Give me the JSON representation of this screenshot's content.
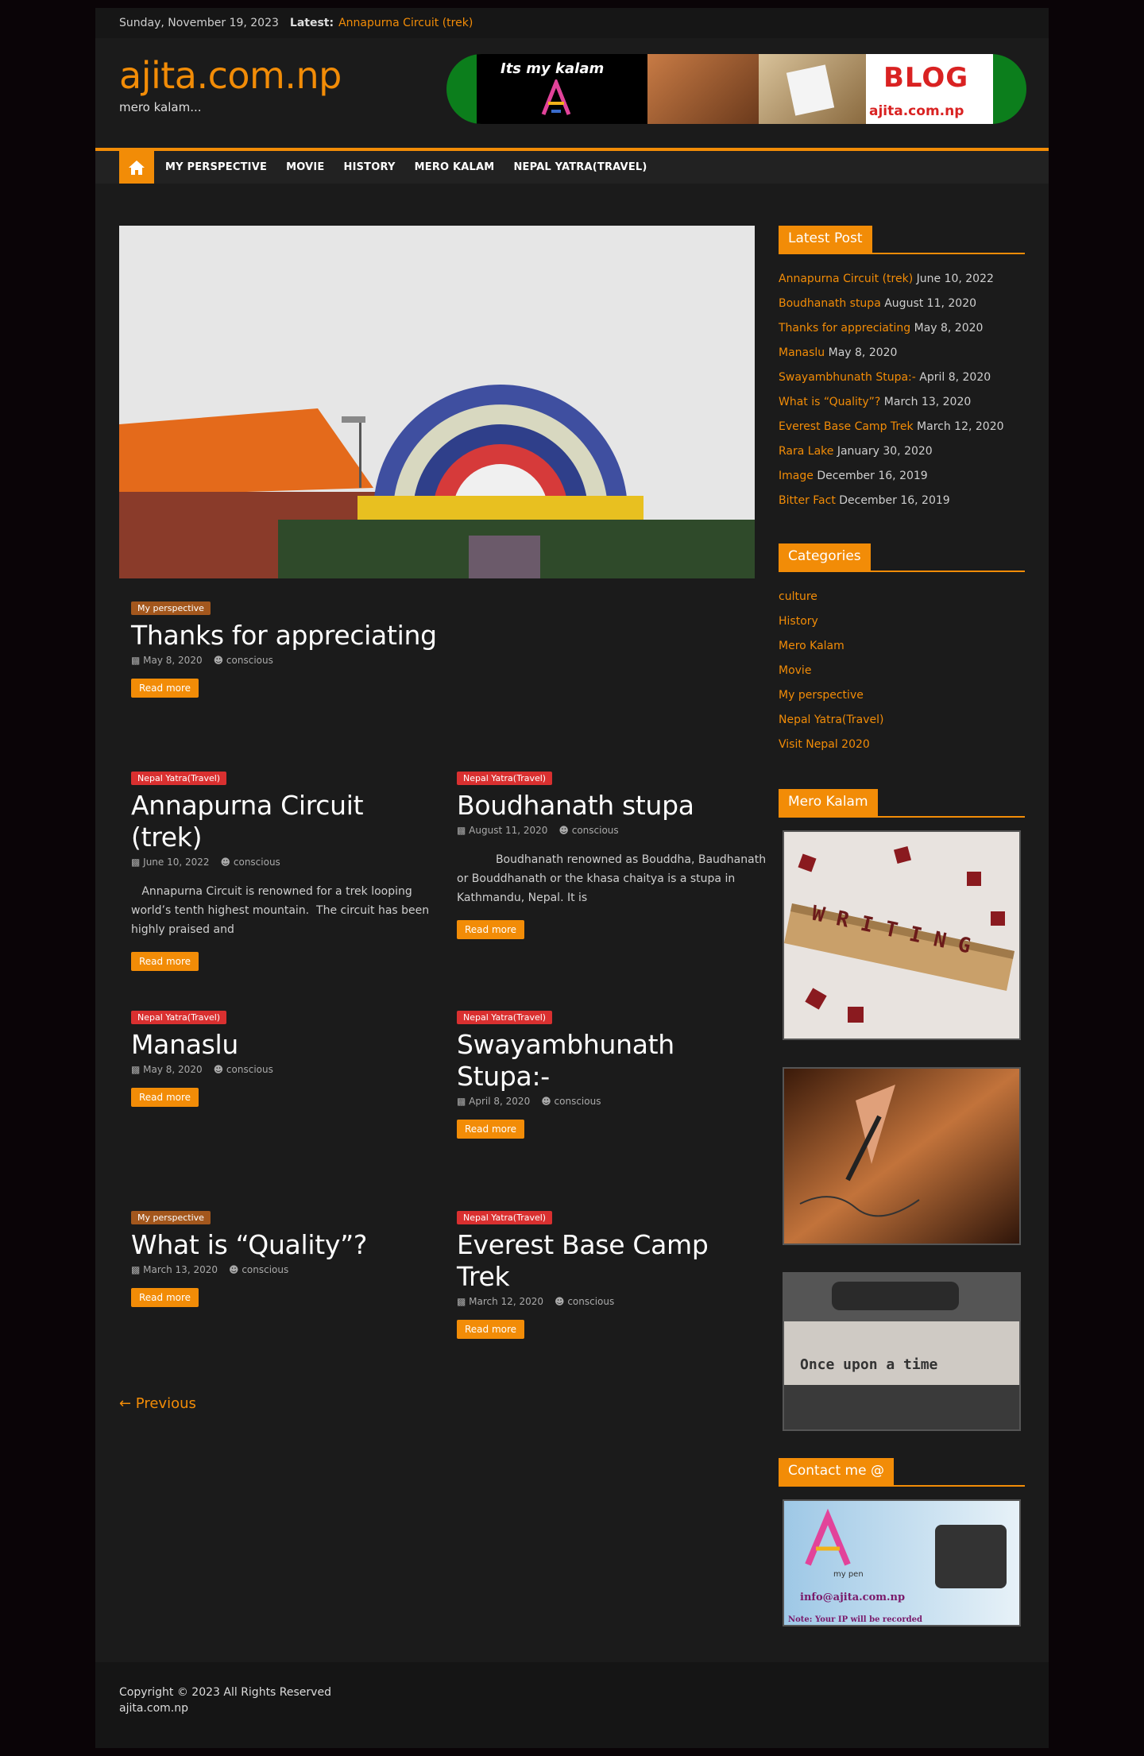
{
  "topbar": {
    "date": "Sunday, November 19, 2023",
    "latest_label": "Latest:",
    "latest_link": "Annapurna Circuit (trek)"
  },
  "site": {
    "title": "ajita.com.np",
    "tagline": "mero kalam..."
  },
  "banner": {
    "text1": "Its my kalam",
    "text2": "BLOG",
    "text3": "ajita.com.np"
  },
  "nav": {
    "items": [
      "MY PERSPECTIVE",
      "MOVIE",
      "HISTORY",
      "MERO KALAM",
      "NEPAL YATRA(TRAVEL)"
    ]
  },
  "featured": {
    "category": "My perspective",
    "title": "Thanks for appreciating",
    "date": "May 8, 2020",
    "author": "conscious",
    "read_more": "Read more"
  },
  "posts": [
    {
      "category": "Nepal Yatra(Travel)",
      "title": "Annapurna Circuit (trek)",
      "date": "June 10, 2022",
      "author": "conscious",
      "excerpt": "   Annapurna Circuit is renowned for a trek looping world’s tenth highest mountain.  The circuit has been highly praised and",
      "read_more": "Read more"
    },
    {
      "category": "Nepal Yatra(Travel)",
      "title": "Boudhanath stupa",
      "date": "August 11, 2020",
      "author": "conscious",
      "excerpt": "           Boudhanath renowned as Bouddha, Baudhanath or Bouddhanath or the khasa chaitya is a stupa in Kathmandu, Nepal. It is",
      "read_more": "Read more"
    },
    {
      "category": "Nepal Yatra(Travel)",
      "title": "Manaslu",
      "date": "May 8, 2020",
      "author": "conscious",
      "read_more": "Read more"
    },
    {
      "category": "Nepal Yatra(Travel)",
      "title": "Swayambhunath Stupa:-",
      "date": "April 8, 2020",
      "author": "conscious",
      "read_more": "Read more"
    },
    {
      "category": "My perspective",
      "title": "What is “Quality”?",
      "date": "March 13, 2020",
      "author": "conscious",
      "read_more": "Read more"
    },
    {
      "category": "Nepal Yatra(Travel)",
      "title": "Everest Base Camp Trek",
      "date": "March 12, 2020",
      "author": "conscious",
      "read_more": "Read more"
    }
  ],
  "pagination": {
    "previous": "← Previous"
  },
  "sidebar": {
    "latest_title": "Latest Post",
    "latest": [
      {
        "title": "Annapurna Circuit (trek)",
        "date": "June 10, 2022"
      },
      {
        "title": "Boudhanath stupa",
        "date": "August 11, 2020"
      },
      {
        "title": "Thanks for appreciating",
        "date": "May 8, 2020"
      },
      {
        "title": "Manaslu",
        "date": "May 8, 2020"
      },
      {
        "title": "Swayambhunath Stupa:-",
        "date": "April 8, 2020"
      },
      {
        "title": "What is “Quality”?",
        "date": "March 13, 2020"
      },
      {
        "title": "Everest Base Camp Trek",
        "date": "March 12, 2020"
      },
      {
        "title": "Rara Lake",
        "date": "January 30, 2020"
      },
      {
        "title": "Image",
        "date": "December 16, 2019"
      },
      {
        "title": "Bitter Fact",
        "date": "December 16, 2019"
      }
    ],
    "categories_title": "Categories",
    "categories": [
      "culture",
      "History",
      "Mero Kalam",
      "Movie",
      "My perspective",
      "Nepal Yatra(Travel)",
      "Visit Nepal 2020"
    ],
    "mero_kalam_title": "Mero Kalam",
    "img_writing_text": "W R I T I N G",
    "img_typewriter_text": "Once upon a time",
    "contact_title": "Contact me @",
    "contact_email": "info@ajita.com.np",
    "contact_note": "Note: Your IP will be recorded",
    "contact_logo_text": "my pen"
  },
  "footer": {
    "copyright": "Copyright © 2023 All Rights Reserved",
    "site": "ajita.com.np"
  },
  "colors": {
    "accent": "#f28c07",
    "travel_badge": "#d93030",
    "perspective_badge": "#a3571d"
  }
}
